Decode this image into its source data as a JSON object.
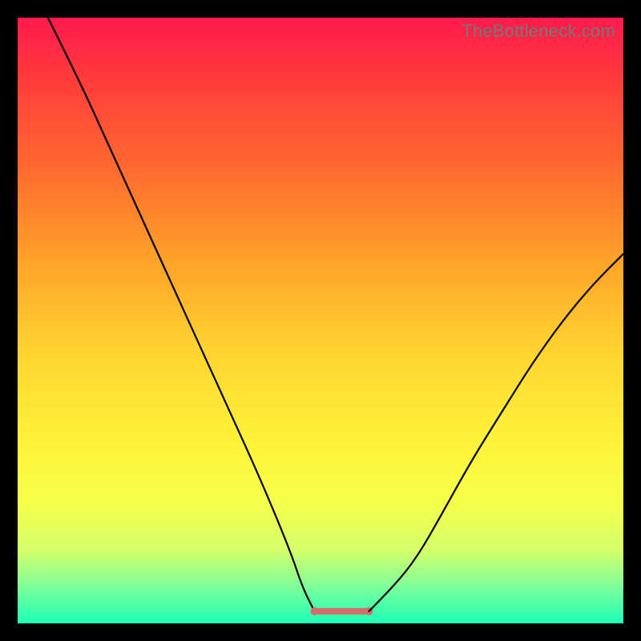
{
  "watermark": "TheBottleneck.com",
  "chart_data": {
    "type": "line",
    "title": "",
    "xlabel": "",
    "ylabel": "",
    "xlim": [
      0,
      100
    ],
    "ylim": [
      0,
      100
    ],
    "series": [
      {
        "name": "curve-left",
        "x": [
          5,
          10,
          15,
          20,
          25,
          30,
          35,
          40,
          45,
          47,
          49
        ],
        "y": [
          100,
          90,
          79,
          68,
          57,
          46,
          35,
          24,
          12,
          6,
          2
        ]
      },
      {
        "name": "flat-bottom",
        "x": [
          49,
          58
        ],
        "y": [
          2,
          2
        ],
        "color": "#d86a6a",
        "width": 8
      },
      {
        "name": "curve-right",
        "x": [
          58,
          62,
          66,
          70,
          75,
          80,
          85,
          90,
          95,
          100
        ],
        "y": [
          2,
          6,
          11,
          18,
          27,
          35,
          43,
          50,
          56,
          61
        ]
      }
    ]
  }
}
